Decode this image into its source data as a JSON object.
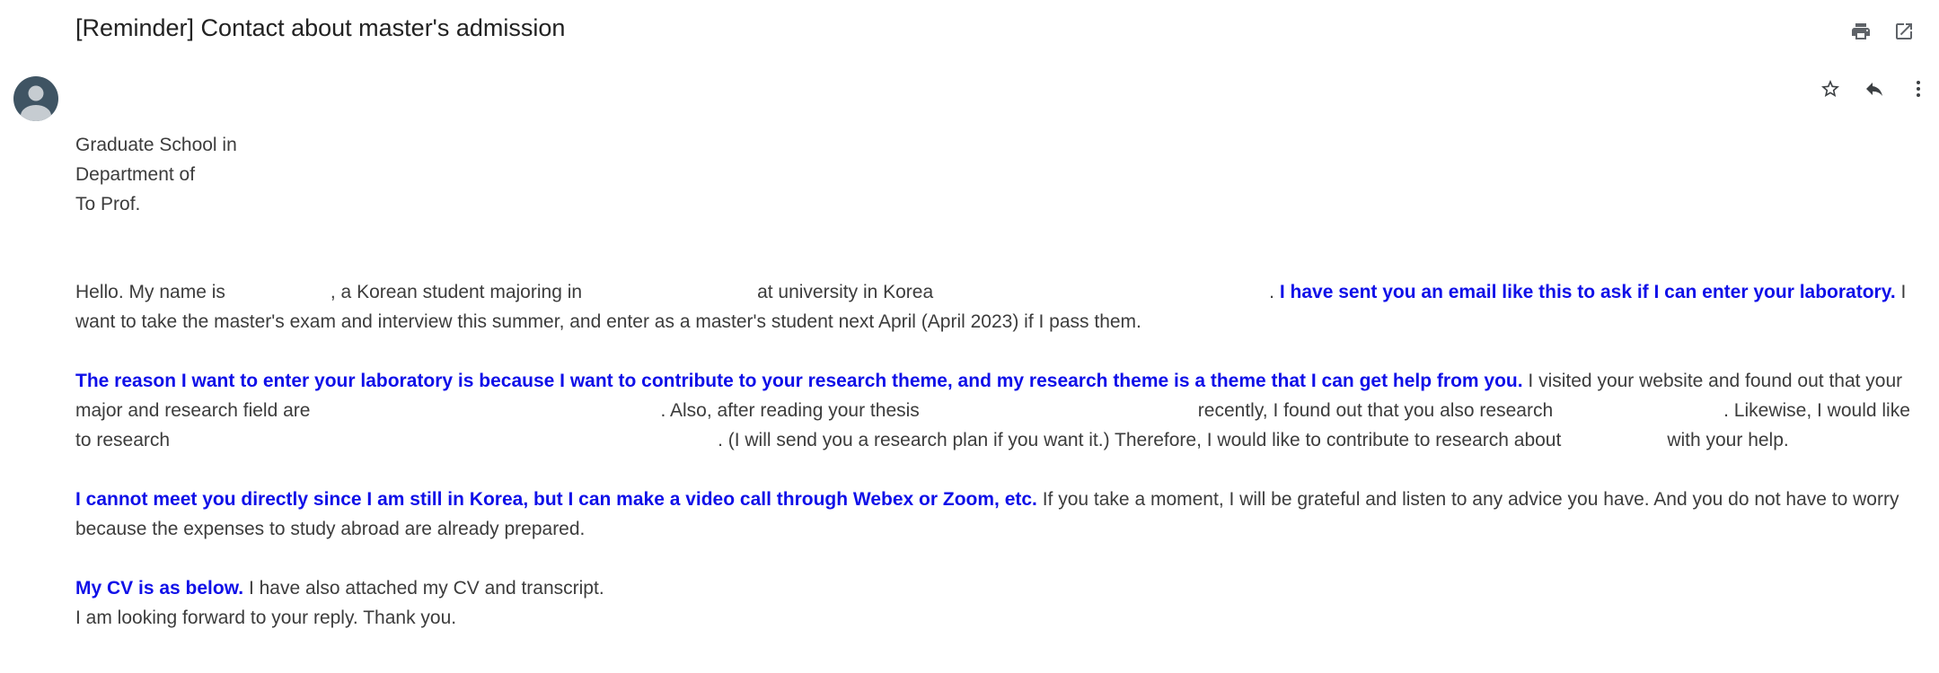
{
  "email": {
    "subject": "[Reminder] Contact about master's admission",
    "header": {
      "line1": "Graduate School in",
      "line2": "Department of",
      "line3": "To Prof."
    },
    "p1": {
      "a": "Hello. My name is",
      "b": ", a Korean student majoring in",
      "c": "at university in Korea",
      "d": ". ",
      "bold": "I have sent you an email like this to ask if I can enter your laboratory.",
      "e": " I want to take the master's exam and interview this summer, and enter as a master's student next April (April 2023) if I pass them."
    },
    "p2": {
      "bold": "The reason I want to enter your laboratory is because I want to contribute to your research theme, and my research theme is a theme that I can get help from you.",
      "a": " I visited your website and found out that your major and research field are",
      "b": ". Also, after reading your thesis",
      "c": "recently, I found out that you also research",
      "d": ". Likewise, I would like to research",
      "e": ". (I will send you a research plan if you want it.) Therefore, I would like to contribute to research about",
      "f": "with your help."
    },
    "p3": {
      "bold": "I cannot meet you directly since I am still in Korea, but I can make a video call through Webex or Zoom, etc.",
      "a": " If you take a moment, I will be grateful and listen to any advice you have. And you do not have to worry because the expenses to study abroad are already prepared."
    },
    "p4": {
      "bold": "My CV is as below.",
      "a": " I have also attached my CV and transcript.",
      "line2": "I am looking forward to your reply. Thank you."
    }
  },
  "icons": {
    "print": "print-icon",
    "open_new_window": "open-in-new-window-icon",
    "star": "star-icon",
    "reply": "reply-icon",
    "more": "more-vertical-icon",
    "avatar": "default-avatar-icon"
  },
  "colors": {
    "emphasis": "#1010e8",
    "text": "#3c3c3c",
    "avatar_bg": "#3f5463"
  }
}
